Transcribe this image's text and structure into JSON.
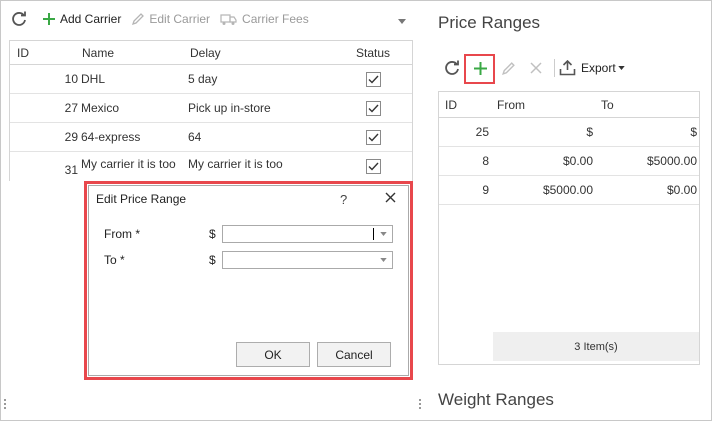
{
  "left_toolbar": {
    "add_label": "Add Carrier",
    "edit_label": "Edit Carrier",
    "fees_label": "Carrier Fees"
  },
  "carriers_grid": {
    "columns": [
      "ID",
      "Name",
      "Delay",
      "Status"
    ],
    "rows": [
      {
        "id": "10",
        "name": "DHL",
        "delay": "5 day",
        "status": true
      },
      {
        "id": "27",
        "name": "Mexico",
        "delay": "Pick up in-store",
        "status": true
      },
      {
        "id": "29",
        "name": "64-express",
        "delay": "64",
        "status": true
      },
      {
        "id": "31",
        "name": "My carrier it is too",
        "delay": "My carrier it is too",
        "status": true
      }
    ]
  },
  "price_ranges": {
    "title": "Price Ranges",
    "export_label": "Export",
    "columns": [
      "ID",
      "From",
      "To"
    ],
    "rows": [
      {
        "id": "25",
        "from": "$",
        "to": "$"
      },
      {
        "id": "8",
        "from": "$0.00",
        "to": "$5000.00"
      },
      {
        "id": "9",
        "from": "$5000.00",
        "to": "$0.00"
      }
    ],
    "footer": "3 Item(s)"
  },
  "weight_ranges": {
    "title": "Weight Ranges"
  },
  "dialog": {
    "title": "Edit Price Range",
    "help": "?",
    "from_label": "From *",
    "to_label": "To *",
    "currency": "$",
    "from_value": "",
    "to_value": "",
    "ok_label": "OK",
    "cancel_label": "Cancel"
  },
  "colors": {
    "highlight": "#e8474c",
    "add_green": "#3aa845"
  }
}
